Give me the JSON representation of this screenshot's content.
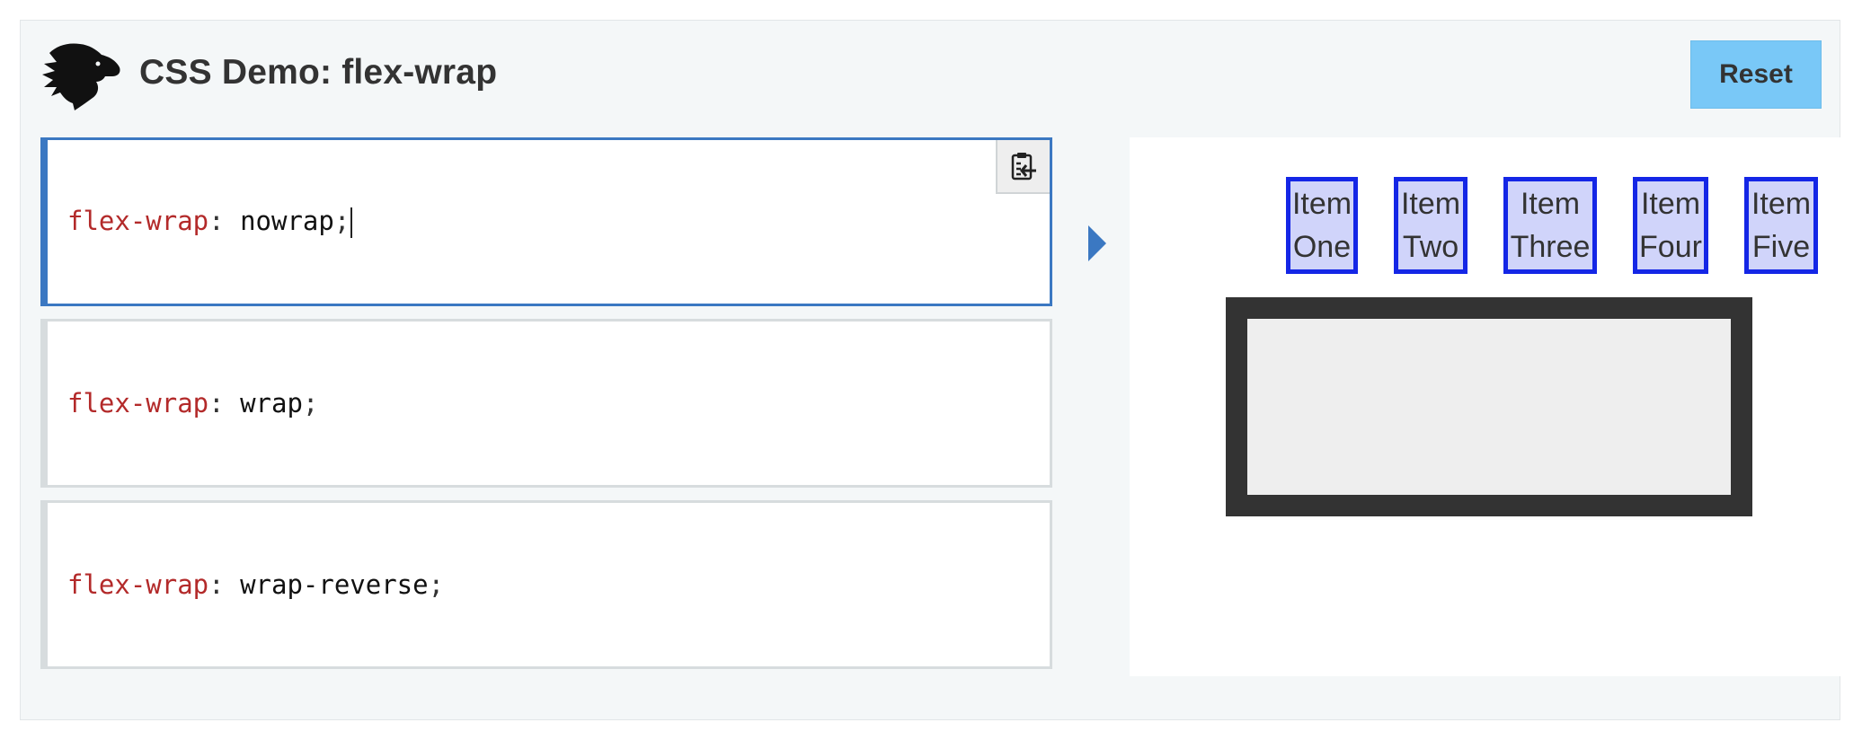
{
  "header": {
    "title": "CSS Demo: flex-wrap",
    "reset_label": "Reset",
    "logo_icon": "dinosaur-head-icon"
  },
  "editor": {
    "choices": [
      {
        "property": "flex-wrap",
        "colon": ": ",
        "value": "nowrap",
        "semi": ";",
        "selected": true
      },
      {
        "property": "flex-wrap",
        "colon": ": ",
        "value": "wrap",
        "semi": ";",
        "selected": false
      },
      {
        "property": "flex-wrap",
        "colon": ": ",
        "value": "wrap-reverse",
        "semi": ";",
        "selected": false
      }
    ],
    "copy_icon": "clipboard-copy-icon"
  },
  "output": {
    "items": [
      {
        "line1": "Item",
        "line2": "One"
      },
      {
        "line1": "Item",
        "line2": "Two"
      },
      {
        "line1": "Item",
        "line2": "Three"
      },
      {
        "line1": "Item",
        "line2": "Four"
      },
      {
        "line1": "Item",
        "line2": "Five"
      }
    ]
  },
  "colors": {
    "accent": "#3b78c2",
    "reset_bg": "#79c8f7",
    "property": "#b32a2a",
    "item_border": "#1426e6",
    "container": "#333333"
  }
}
